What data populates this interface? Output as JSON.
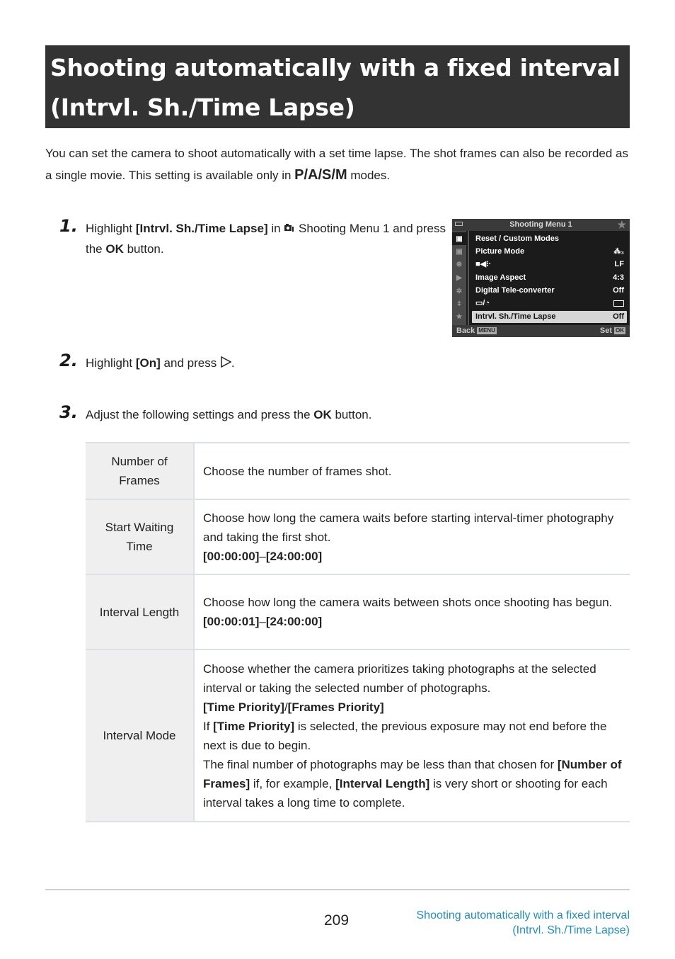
{
  "title": {
    "line1": "Shooting automatically with a fixed interval",
    "line2": "(Intrvl. Sh./Time Lapse)"
  },
  "intro": {
    "text1": "You can set the camera to shoot automatically with a set time lapse. The shot frames can also be recorded as a single movie. This setting is available only in ",
    "modes": "P/A/S/M",
    "text2": " modes."
  },
  "steps": [
    {
      "number": "1.",
      "parts": {
        "a": "Highlight ",
        "b": "[Intrvl. Sh./Time Lapse]",
        "c": " in ",
        "icon": "shooting-menu-1-icon",
        "d": " Shooting Menu 1 and press the ",
        "e": "OK",
        "f": " button."
      }
    },
    {
      "number": "2.",
      "parts": {
        "a": "Highlight ",
        "b": "[On]",
        "c": " and press ",
        "icon": "right-arrow-icon",
        "d": "."
      }
    },
    {
      "number": "3.",
      "parts": {
        "a": "Adjust the following settings and press the ",
        "b": "OK",
        "c": " button."
      }
    }
  ],
  "camera_menu": {
    "title": "Shooting Menu 1",
    "side_tabs": [
      "shooting-menu-1",
      "shooting-menu-2",
      "video-menu",
      "playback-menu",
      "custom-menu",
      "setup-menu",
      "my-menu"
    ],
    "rows": [
      {
        "label": "Reset / Custom Modes",
        "value": ""
      },
      {
        "label": "Picture Mode",
        "value": "i-Enhance 3",
        "value_icon": "picture-mode-icon"
      },
      {
        "label": "Image quality",
        "label_icon": "camera-quality-icon",
        "value": "LF"
      },
      {
        "label": "Image Aspect",
        "value": "4:3"
      },
      {
        "label": "Digital Tele-converter",
        "value": "Off"
      },
      {
        "label": "Drive / Self-timer",
        "label_icon": "drive-selftimer-icon",
        "value": "single",
        "value_icon": "single-frame-icon"
      },
      {
        "label": "Intrvl. Sh./Time Lapse",
        "value": "Off",
        "selected": true
      }
    ],
    "footer": {
      "back": "Back",
      "back_key": "MENU",
      "set": "Set",
      "set_key": "OK"
    }
  },
  "table": [
    {
      "label": "Number of Frames",
      "lines": [
        {
          "text": "Choose the number of frames shot."
        }
      ]
    },
    {
      "label": "Start Waiting Time",
      "lines": [
        {
          "text": "Choose how long the camera waits before starting interval-timer photography and taking the first shot."
        },
        {
          "bold1": "[00:00:00]",
          "sep": "–",
          "bold2": "[24:00:00]"
        }
      ]
    },
    {
      "label": "Interval Length",
      "lines": [
        {
          "text": "Choose how long the camera waits between shots once shooting has begun."
        },
        {
          "bold1": "[00:00:01]",
          "sep": "–",
          "bold2": "[24:00:00]"
        }
      ]
    },
    {
      "label": "Interval Mode",
      "lines": [
        {
          "text": "Choose whether the camera prioritizes taking photographs at the selected interval or taking the selected number of photographs."
        },
        {
          "bold1": "[Time Priority]",
          "sep": "/",
          "bold2": "[Frames Priority]"
        },
        {
          "pre": "If ",
          "b": "[Time Priority]",
          "post": " is selected, the previous exposure may not end before the next is due to begin."
        },
        {
          "text": "The final number of photographs may be less than that chosen for "
        },
        {
          "b1": "[Number of Frames]",
          "m": " if, for example, ",
          "b2": "[Interval Length]",
          "post": " is very short or shooting for each interval takes a long time to complete."
        }
      ]
    }
  ],
  "footer": {
    "page_number": "209",
    "link_line1": "Shooting automatically with a fixed interval",
    "link_line2": "(Intrvl. Sh./Time Lapse)"
  }
}
